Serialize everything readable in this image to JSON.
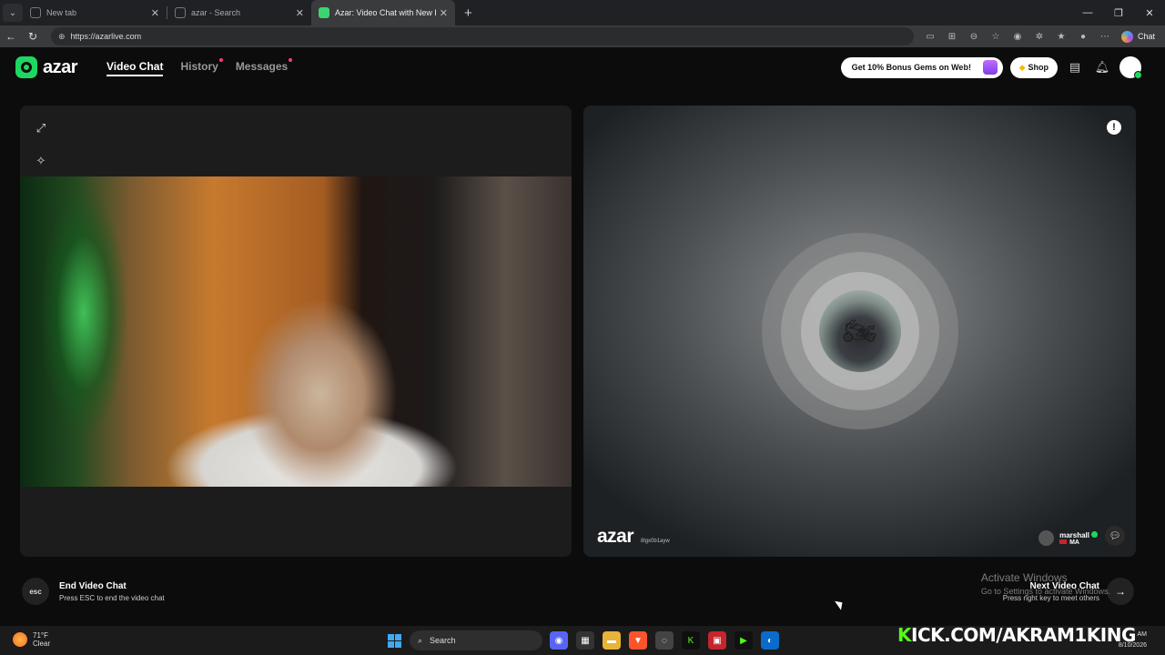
{
  "browser": {
    "tabs": [
      {
        "label": "New tab"
      },
      {
        "label": "azar - Search"
      },
      {
        "label": "Azar: Video Chat with New Pe"
      }
    ],
    "url": "https://azarlive.com",
    "copilot_label": "Chat"
  },
  "site": {
    "logo_text": "azar",
    "nav": [
      {
        "label": "Video Chat",
        "active": true
      },
      {
        "label": "History",
        "badge": true
      },
      {
        "label": "Messages",
        "badge": true
      }
    ],
    "gems_promo": "Get 10% Bonus Gems on Web!",
    "shop_label": "Shop"
  },
  "right_panel": {
    "watermark": "azar",
    "watermark_id": "8lgx0b1ayw",
    "peer_name": "marshall",
    "peer_country": "MA"
  },
  "footer": {
    "esc_key": "esc",
    "end_title": "End Video Chat",
    "end_sub": "Press ESC to end the video chat",
    "next_title": "Next Video Chat",
    "next_sub": "Press right key to meet others"
  },
  "overlay": {
    "activate_title": "Activate Windows",
    "activate_sub": "Go to Settings to activate Windows."
  },
  "taskbar": {
    "temp": "71°F",
    "weather": "Clear",
    "search": "Search",
    "stream_domain": "KICK.COM/AKRAM1KING",
    "time": "AM",
    "date": "8/10/2026"
  }
}
